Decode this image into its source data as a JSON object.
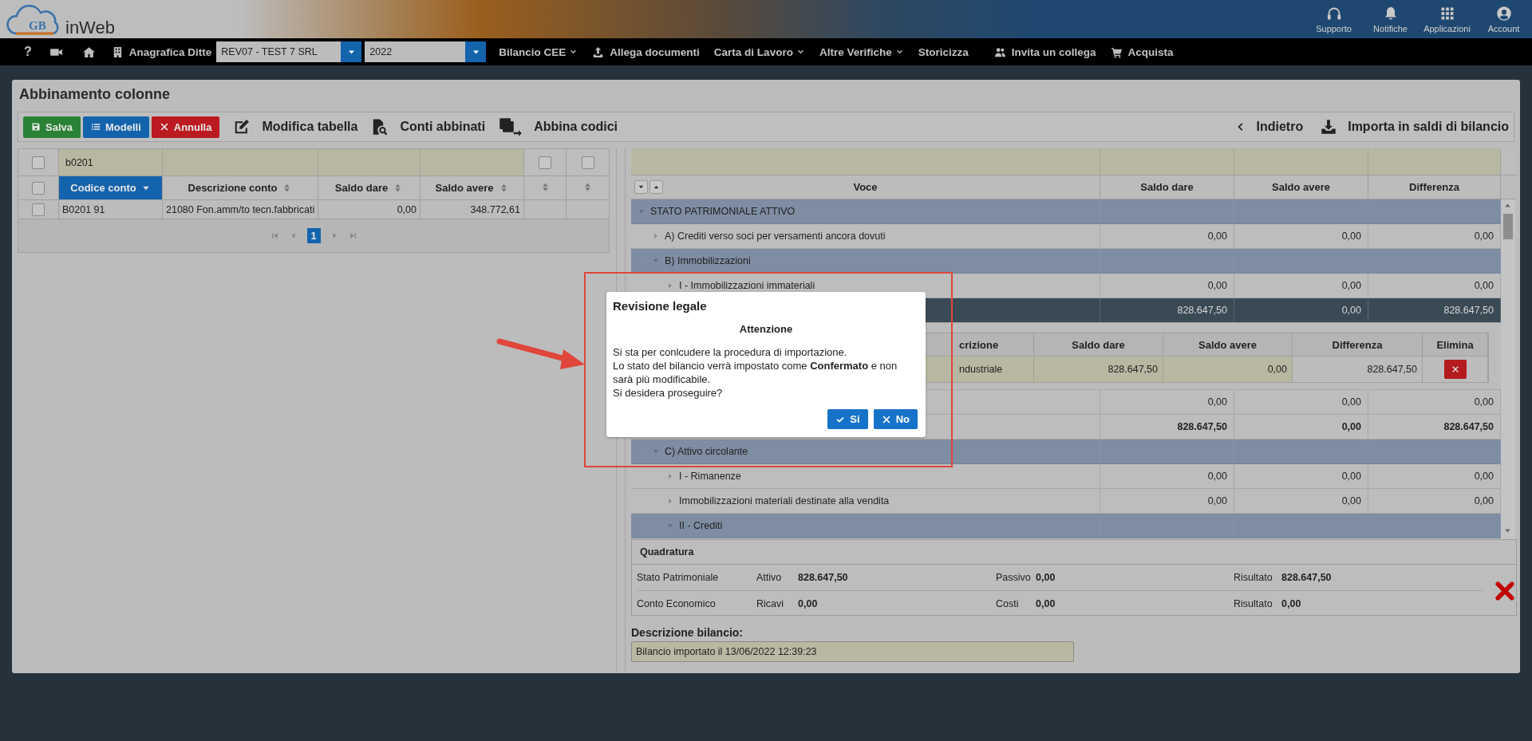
{
  "header": {
    "logo_mark": "GB",
    "logo_text": "inWeb",
    "actions": [
      "Supporto",
      "Notifiche",
      "Applicazioni",
      "Account"
    ]
  },
  "nav": {
    "help": "?",
    "company_label": "Anagrafica Ditte",
    "company": "REV07 - TEST 7 SRL",
    "year": "2022",
    "menus": [
      {
        "label": "Bilancio CEE",
        "dropdown": true
      },
      {
        "label": "Allega documenti",
        "dropdown": false
      },
      {
        "label": "Carta di Lavoro",
        "dropdown": true
      },
      {
        "label": "Altre Verifiche",
        "dropdown": true
      },
      {
        "label": "Storicizza",
        "dropdown": false
      },
      {
        "label": "Invita un collega",
        "dropdown": false
      },
      {
        "label": "Acquista",
        "dropdown": false
      }
    ]
  },
  "page": {
    "title": "Abbinamento colonne"
  },
  "toolbar": {
    "buttons": [
      {
        "label": "Salva",
        "kind": "save"
      },
      {
        "label": "Modelli",
        "kind": "models"
      },
      {
        "label": "Annulla",
        "kind": "cancel"
      }
    ],
    "tools": [
      "Modifica tabella",
      "Conti abbinati",
      "Abbina codici"
    ],
    "right_tools": [
      "Indietro",
      "Importa in saldi di bilancio"
    ]
  },
  "left_table": {
    "filter_checked": false,
    "filter_value": "b0201",
    "filter_checks": [
      false,
      false
    ],
    "header_checked": false,
    "columns": [
      {
        "label": "Codice conto",
        "sorted": true
      },
      {
        "label": "Descrizione conto",
        "sorted": false
      },
      {
        "label": "Saldo dare",
        "sorted": false
      },
      {
        "label": "Saldo avere",
        "sorted": false
      },
      {
        "sorted": false
      },
      {
        "sorted": false
      }
    ],
    "rows": [
      {
        "checked": false,
        "cells": [
          "B0201 91",
          "21080 Fon.amm/to tecn.fabbricati",
          "0,00",
          "348.772,61"
        ]
      }
    ],
    "pages": [
      {
        "label": "1",
        "selected": true
      }
    ]
  },
  "tree": {
    "columns": [
      "Voce",
      "Saldo dare",
      "Saldo avere",
      "Differenza"
    ],
    "rows": [
      {
        "kind": "group",
        "label": "STATO PATRIMONIALE ATTIVO",
        "expanded": true,
        "children": [
          {
            "kind": "item",
            "label": "A) Crediti verso soci per versamenti ancora dovuti",
            "expanded": false,
            "values": [
              "0,00",
              "0,00",
              "0,00"
            ]
          },
          {
            "kind": "group",
            "label": "B) Immobilizzazioni",
            "expanded": true,
            "children": [
              {
                "kind": "item",
                "label": "I - Immobilizzazioni immateriali",
                "expanded": false,
                "values": [
                  "0,00",
                  "0,00",
                  "0,00"
                ]
              },
              {
                "kind": "current",
                "values": [
                  "828.647,50",
                  "0,00",
                  "828.647,50"
                ],
                "detail": {
                  "columns": [
                    "crizione",
                    "Saldo dare",
                    "Saldo avere",
                    "Differenza",
                    "Elimina"
                  ],
                  "rows": [
                    {
                      "cells": [
                        "ndustriale",
                        "828.647,50",
                        "0,00",
                        "828.647,50"
                      ]
                    }
                  ]
                }
              },
              {
                "kind": "item",
                "values": [
                  "0,00",
                  "0,00",
                  "0,00"
                ]
              },
              {
                "kind": "total",
                "values": [
                  "828.647,50",
                  "0,00",
                  "828.647,50"
                ]
              }
            ]
          },
          {
            "kind": "group",
            "label": "C) Attivo circolante",
            "expanded": true,
            "children": [
              {
                "kind": "item",
                "label": "I - Rimanenze",
                "expanded": false,
                "values": [
                  "0,00",
                  "0,00",
                  "0,00"
                ]
              },
              {
                "kind": "item",
                "label": "Immobilizzazioni materiali destinate alla vendita",
                "expanded": false,
                "values": [
                  "0,00",
                  "0,00",
                  "0,00"
                ]
              },
              {
                "kind": "group",
                "label": "II - Crediti",
                "expanded": true
              }
            ]
          }
        ]
      }
    ]
  },
  "quadratura": {
    "title": "Quadratura",
    "balanced": false,
    "rows": [
      {
        "label": "Stato Patrimoniale",
        "items": [
          {
            "label": "Attivo",
            "value": "828.647,50"
          },
          {
            "label": "Passivo",
            "value": "0,00"
          },
          {
            "label": "Risultato",
            "value": "828.647,50"
          }
        ]
      },
      {
        "label": "Conto Economico",
        "items": [
          {
            "label": "Ricavi",
            "value": "0,00"
          },
          {
            "label": "Costi",
            "value": "0,00"
          },
          {
            "label": "Risultato",
            "value": "0,00"
          }
        ]
      }
    ]
  },
  "description": {
    "label": "Descrizione bilancio:",
    "value": "Bilancio importato il 13/06/2022 12:39:23"
  },
  "dialog": {
    "title": "Revisione legale",
    "heading": "Attenzione",
    "lines": [
      "Si sta per conlcudere la procedura di importazione.",
      "Lo stato del bilancio verrà impostato come **Confermato** e non sarà più modificabile.",
      "Si desidera proseguire?"
    ],
    "buttons": [
      {
        "label": "Si",
        "kind": "confirm"
      },
      {
        "label": "No",
        "kind": "cancel"
      }
    ]
  }
}
